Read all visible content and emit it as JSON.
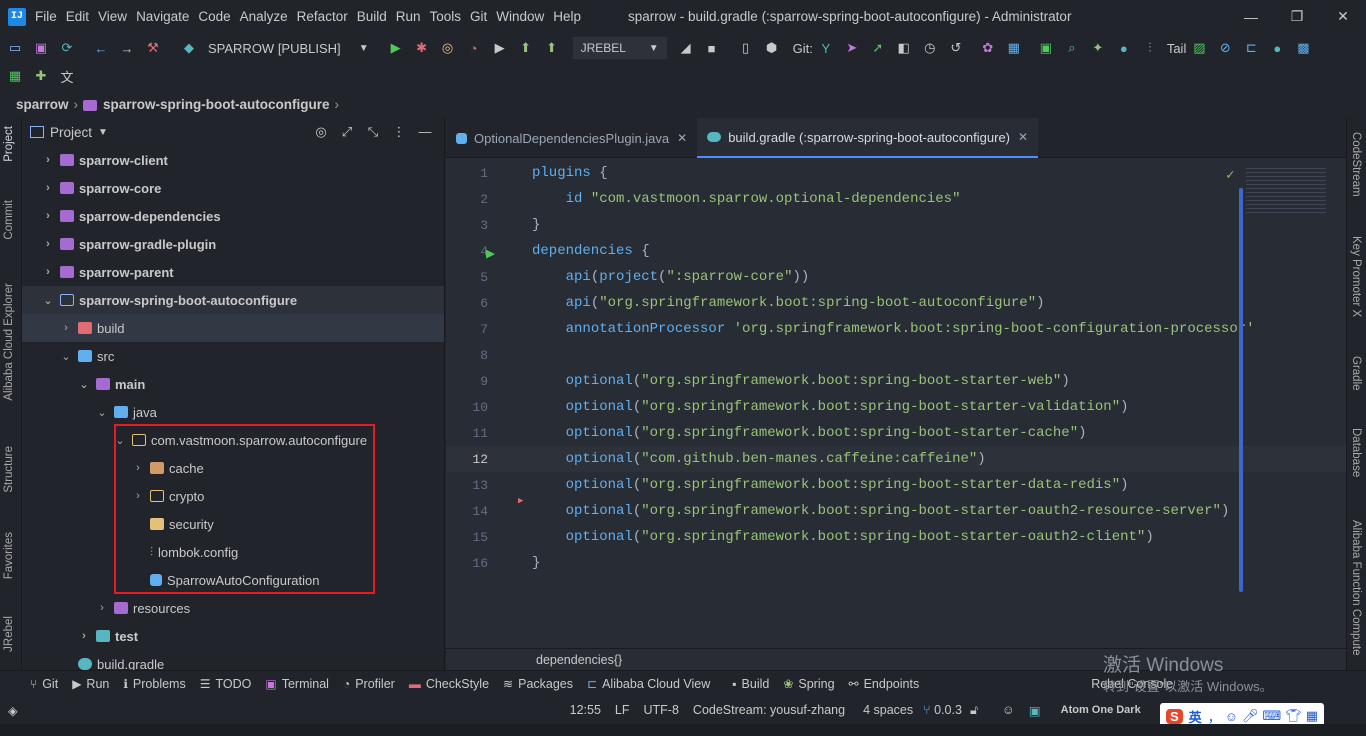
{
  "menubar": {
    "app_logo": "IJ",
    "items": [
      "File",
      "Edit",
      "View",
      "Navigate",
      "Code",
      "Analyze",
      "Refactor",
      "Build",
      "Run",
      "Tools",
      "Git",
      "Window",
      "Help"
    ],
    "title": "sparrow - build.gradle (:sparrow-spring-boot-autoconfigure) - Administrator",
    "controls": [
      "—",
      "❐",
      "✕"
    ]
  },
  "toolbar": {
    "run_config": "SPARROW [PUBLISH]",
    "jrebel": "JREBEL",
    "git_label": "Git:",
    "tail_label": "Tail"
  },
  "breadcrumb": {
    "root": "sparrow",
    "module": "sparrow-spring-boot-autoconfigure"
  },
  "left_tabs": [
    "Project",
    "Commit",
    "Alibaba Cloud Explorer",
    "Structure",
    "Favorites",
    "JRebel"
  ],
  "right_tabs": [
    "CodeStream",
    "Key Promoter X",
    "Gradle",
    "Database",
    "Alibaba Function Compute"
  ],
  "project_panel": {
    "title": "Project",
    "tree": [
      {
        "label": "sparrow-client",
        "icon": "module-folder-icon"
      },
      {
        "label": "sparrow-core",
        "icon": "module-folder-icon"
      },
      {
        "label": "sparrow-dependencies",
        "icon": "module-folder-icon"
      },
      {
        "label": "sparrow-gradle-plugin",
        "icon": "module-folder-icon"
      },
      {
        "label": "sparrow-parent",
        "icon": "module-folder-icon"
      },
      {
        "label": "sparrow-spring-boot-autoconfigure",
        "icon": "module-folder-icon"
      },
      {
        "label": "build",
        "icon": "excluded-folder-icon"
      },
      {
        "label": "src",
        "icon": "source-folder-icon"
      },
      {
        "label": "main",
        "icon": "module-folder-icon"
      },
      {
        "label": "java",
        "icon": "source-root-icon"
      },
      {
        "label": "com.vastmoon.sparrow.autoconfigure",
        "icon": "package-icon"
      },
      {
        "label": "cache",
        "icon": "package-icon"
      },
      {
        "label": "crypto",
        "icon": "package-icon"
      },
      {
        "label": "security",
        "icon": "folder-icon"
      },
      {
        "label": "lombok.config",
        "icon": "config-file-icon"
      },
      {
        "label": "SparrowAutoConfiguration",
        "icon": "class-icon"
      },
      {
        "label": "resources",
        "icon": "resources-folder-icon"
      },
      {
        "label": "test",
        "icon": "test-folder-icon"
      },
      {
        "label": "build.gradle",
        "icon": "gradle-icon"
      }
    ]
  },
  "editor": {
    "tabs": [
      {
        "label": "OptionalDependenciesPlugin.java",
        "close": "✕"
      },
      {
        "label": "build.gradle (:sparrow-spring-boot-autoconfigure)",
        "close": "✕"
      }
    ],
    "lines": [
      {
        "n": "1",
        "parts": [
          [
            "k-fn",
            "plugins"
          ],
          [
            "k-plain",
            " {"
          ]
        ]
      },
      {
        "n": "2",
        "parts": [
          [
            "k-plain",
            "    "
          ],
          [
            "k-fn",
            "id"
          ],
          [
            "k-plain",
            " "
          ],
          [
            "k-str",
            "\"com.vastmoon.sparrow.optional-dependencies\""
          ]
        ]
      },
      {
        "n": "3",
        "parts": [
          [
            "k-plain",
            "}"
          ]
        ]
      },
      {
        "n": "4",
        "parts": [
          [
            "k-fn",
            "dependencies"
          ],
          [
            "k-plain",
            " {"
          ]
        ]
      },
      {
        "n": "5",
        "parts": [
          [
            "k-plain",
            "    "
          ],
          [
            "k-fn",
            "api"
          ],
          [
            "k-plain",
            "("
          ],
          [
            "k-fn",
            "project"
          ],
          [
            "k-plain",
            "("
          ],
          [
            "k-str",
            "\":sparrow-core\""
          ],
          [
            "k-plain",
            "))"
          ]
        ]
      },
      {
        "n": "6",
        "parts": [
          [
            "k-plain",
            "    "
          ],
          [
            "k-fn",
            "api"
          ],
          [
            "k-plain",
            "("
          ],
          [
            "k-str",
            "\"org.springframework.boot:spring-boot-autoconfigure\""
          ],
          [
            "k-plain",
            ")"
          ]
        ]
      },
      {
        "n": "7",
        "parts": [
          [
            "k-plain",
            "    "
          ],
          [
            "k-fn",
            "annotationProcessor"
          ],
          [
            "k-plain",
            " "
          ],
          [
            "k-str",
            "'org.springframework.boot:spring-boot-configuration-processor'"
          ]
        ]
      },
      {
        "n": "8",
        "parts": []
      },
      {
        "n": "9",
        "parts": [
          [
            "k-plain",
            "    "
          ],
          [
            "k-fn",
            "optional"
          ],
          [
            "k-plain",
            "("
          ],
          [
            "k-str",
            "\"org.springframework.boot:spring-boot-starter-web\""
          ],
          [
            "k-plain",
            ")"
          ]
        ]
      },
      {
        "n": "10",
        "parts": [
          [
            "k-plain",
            "    "
          ],
          [
            "k-fn",
            "optional"
          ],
          [
            "k-plain",
            "("
          ],
          [
            "k-str",
            "\"org.springframework.boot:spring-boot-starter-validation\""
          ],
          [
            "k-plain",
            ")"
          ]
        ]
      },
      {
        "n": "11",
        "parts": [
          [
            "k-plain",
            "    "
          ],
          [
            "k-fn",
            "optional"
          ],
          [
            "k-plain",
            "("
          ],
          [
            "k-str",
            "\"org.springframework.boot:spring-boot-starter-cache\""
          ],
          [
            "k-plain",
            ")"
          ]
        ]
      },
      {
        "n": "12",
        "parts": [
          [
            "k-plain",
            "    "
          ],
          [
            "k-fn",
            "optional"
          ],
          [
            "k-plain",
            "("
          ],
          [
            "k-str",
            "\"com.github.ben-manes.caffeine:caffeine\""
          ],
          [
            "k-plain",
            ")"
          ]
        ]
      },
      {
        "n": "13",
        "parts": [
          [
            "k-plain",
            "    "
          ],
          [
            "k-fn",
            "optional"
          ],
          [
            "k-plain",
            "("
          ],
          [
            "k-str",
            "\"org.springframework.boot:spring-boot-starter-data-redis\""
          ],
          [
            "k-plain",
            ")"
          ]
        ]
      },
      {
        "n": "14",
        "parts": [
          [
            "k-plain",
            "    "
          ],
          [
            "k-fn",
            "optional"
          ],
          [
            "k-plain",
            "("
          ],
          [
            "k-str",
            "\"org.springframework.boot:spring-boot-starter-oauth2-resource-server\""
          ],
          [
            "k-plain",
            ")"
          ]
        ]
      },
      {
        "n": "15",
        "parts": [
          [
            "k-plain",
            "    "
          ],
          [
            "k-fn",
            "optional"
          ],
          [
            "k-plain",
            "("
          ],
          [
            "k-str",
            "\"org.springframework.boot:spring-boot-starter-oauth2-client\""
          ],
          [
            "k-plain",
            ")"
          ]
        ]
      },
      {
        "n": "16",
        "parts": [
          [
            "k-plain",
            "}"
          ]
        ]
      }
    ],
    "footer_breadcrumb": "dependencies{}"
  },
  "bottom_tabs": [
    "Git",
    "Run",
    "Problems",
    "TODO",
    "Terminal",
    "Profiler",
    "CheckStyle",
    "Packages",
    "Alibaba Cloud View",
    "Build",
    "Spring",
    "Endpoints",
    "Rebel Console"
  ],
  "status_bar": {
    "position": "12:55",
    "line_sep": "LF",
    "encoding": "UTF-8",
    "codestream": "CodeStream: yousuf-zhang",
    "indent": "4 spaces",
    "version": "0.0.3",
    "theme": "Atom One Dark"
  },
  "watermark": {
    "line1": "激活 Windows",
    "line2": "转到\"设置\"以激活 Windows。"
  },
  "ime": {
    "label": "英"
  },
  "colors": {
    "background": "#21252b",
    "editor_bg": "#282c34",
    "accent": "#528bff",
    "highlight_box": "#e51c23"
  }
}
